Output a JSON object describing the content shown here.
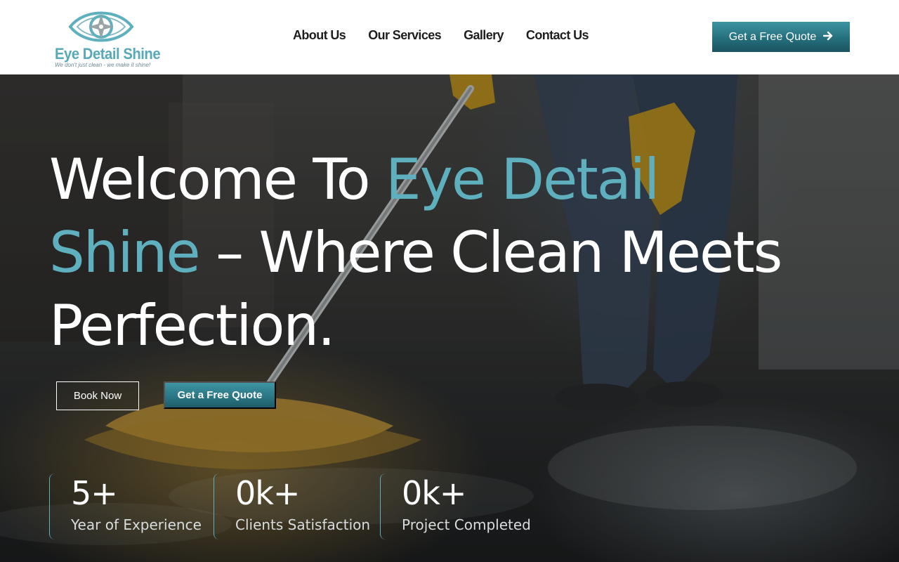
{
  "brand": {
    "name": "Eye Detail Shine",
    "tagline": "We don't just clean - we make it shine!",
    "accent_color": "#5fb0bf",
    "button_color": "#2a7482"
  },
  "nav": {
    "items": [
      {
        "label": "About Us"
      },
      {
        "label": "Our Services"
      },
      {
        "label": "Gallery"
      },
      {
        "label": "Contact Us"
      }
    ],
    "cta_label": "Get a Free Quote",
    "cta_icon": "arrow-right-icon"
  },
  "hero": {
    "headline_prefix": "Welcome To ",
    "headline_accent": "Eye Detail Shine",
    "headline_suffix": " – Where Clean Meets Perfection.",
    "book_label": "Book Now",
    "quote_label": "Get a Free Quote"
  },
  "stats": [
    {
      "value": "5+",
      "label": "Year of Experience"
    },
    {
      "value": "0k+",
      "label": "Clients Satisfaction"
    },
    {
      "value": "0k+",
      "label": "Project Completed"
    }
  ]
}
